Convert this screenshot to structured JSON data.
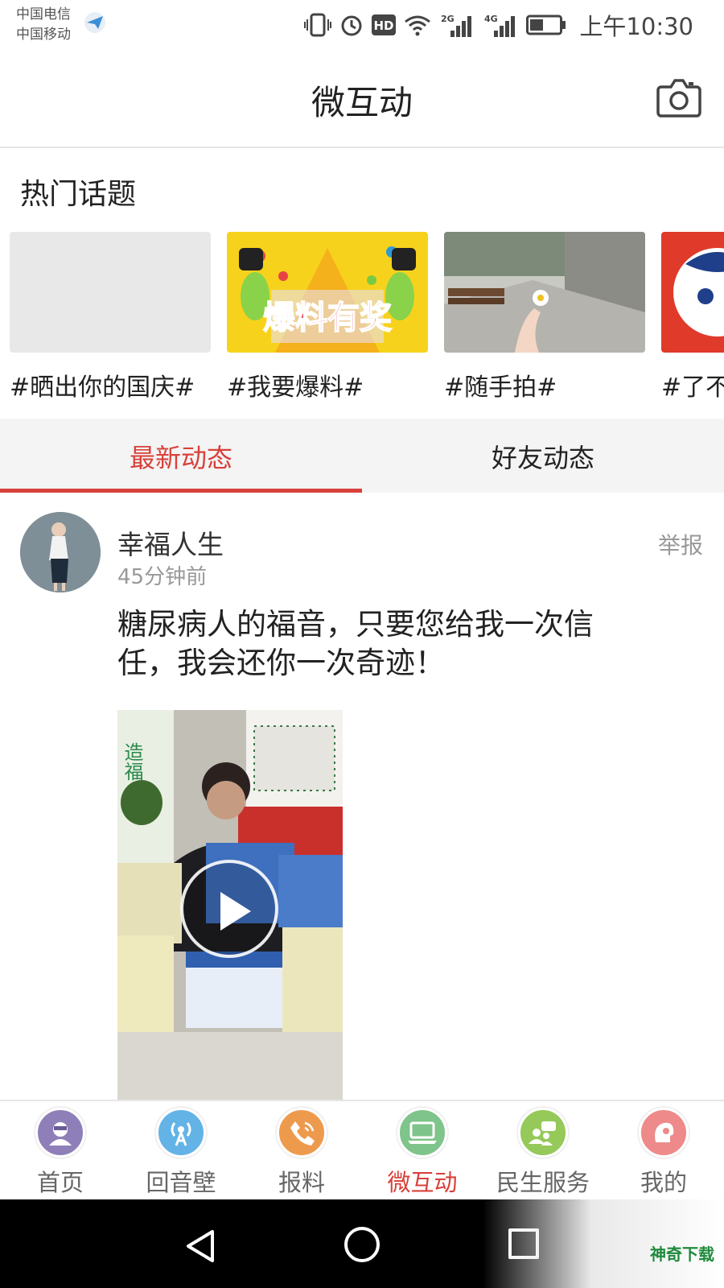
{
  "status": {
    "carrier1": "中国电信",
    "carrier2": "中国移动",
    "net_2g": "2G",
    "net_4g": "4G",
    "hd": "HD",
    "time": "上午10:30"
  },
  "header": {
    "title": "微互动"
  },
  "hot_topics": {
    "title": "热门话题",
    "items": [
      {
        "label": "#晒出你的国庆#"
      },
      {
        "label": "#我要爆料#",
        "image_text": "爆料有奖"
      },
      {
        "label": "#随手拍#"
      },
      {
        "label": "#了不"
      }
    ]
  },
  "tabs": [
    {
      "label": "最新动态",
      "active": true
    },
    {
      "label": "好友动态",
      "active": false
    }
  ],
  "post": {
    "author": "幸福人生",
    "time": "45分钟前",
    "report": "举报",
    "text": "糖尿病人的福音，只要您给我一次信任，我会还你一次奇迹！",
    "video_text": "造福人"
  },
  "bottom_nav": [
    {
      "label": "首页",
      "icon": "home-icon",
      "color": "#8f7fb8"
    },
    {
      "label": "回音壁",
      "icon": "broadcast-icon",
      "color": "#63b3e6"
    },
    {
      "label": "报料",
      "icon": "phone-icon",
      "color": "#ee9a4d"
    },
    {
      "label": "微互动",
      "icon": "computer-icon",
      "color": "#7fc48a",
      "active": true
    },
    {
      "label": "民生服务",
      "icon": "people-chat-icon",
      "color": "#95c95a"
    },
    {
      "label": "我的",
      "icon": "profile-icon",
      "color": "#ee8a8a"
    }
  ],
  "watermark": {
    "text": "神奇下载"
  },
  "colors": {
    "accent": "#d8413a"
  }
}
